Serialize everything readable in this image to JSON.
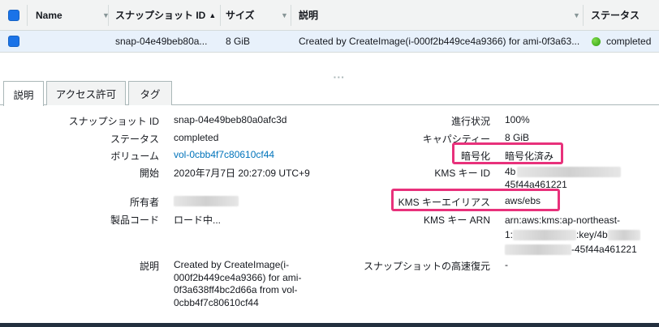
{
  "table": {
    "columns": {
      "name": "Name",
      "snapshot_id": "スナップショット ID",
      "size": "サイズ",
      "description": "説明",
      "status": "ステータス"
    },
    "row": {
      "name": "",
      "snapshot_id": "snap-04e49beb80a...",
      "size": "8 GiB",
      "description": "Created by CreateImage(i-000f2b449ce4a9366) for ami-0f3a63...",
      "status": "completed"
    }
  },
  "tabs": [
    "説明",
    "アクセス許可",
    "タグ"
  ],
  "details_left": {
    "snapshot_id_label": "スナップショット ID",
    "snapshot_id": "snap-04e49beb80a0afc3d",
    "status_label": "ステータス",
    "status": "completed",
    "volume_label": "ボリューム",
    "volume": "vol-0cbb4f7c80610cf44",
    "started_label": "開始",
    "started": "2020年7月7日 20:27:09 UTC+9",
    "owner_label": "所有者",
    "product_code_label": "製品コード",
    "product_code": "ロード中...",
    "description_label": "説明",
    "description_lines": [
      "Created by CreateImage(i-",
      "000f2b449ce4a9366) for ami-",
      "0f3a638ff4bc2d66a from vol-",
      "0cbb4f7c80610cf44"
    ]
  },
  "details_right": {
    "progress_label": "進行状況",
    "progress": "100%",
    "capacity_label": "キャパシティー",
    "capacity": "8 GiB",
    "encryption_label": "暗号化",
    "encryption": "暗号化済み",
    "kms_key_id_label": "KMS キー ID",
    "kms_key_id_line1": "4b",
    "kms_key_id_line2": "45f44a461221",
    "kms_alias_label": "KMS キーエイリアス",
    "kms_alias": "aws/ebs",
    "kms_arn_label": "KMS キー ARN",
    "kms_arn_line1": "arn:aws:kms:ap-northeast-",
    "kms_arn_line2a": "1:",
    "kms_arn_line2b": ":key/4b",
    "kms_arn_line3b": "-45f44a461221",
    "fast_restore_label": "スナップショットの高速復元",
    "fast_restore": "-"
  },
  "colors": {
    "highlight": "#e8317b",
    "link": "#0073bb",
    "status_ok": "#2f9e10",
    "checkbox": "#1a73e8"
  }
}
